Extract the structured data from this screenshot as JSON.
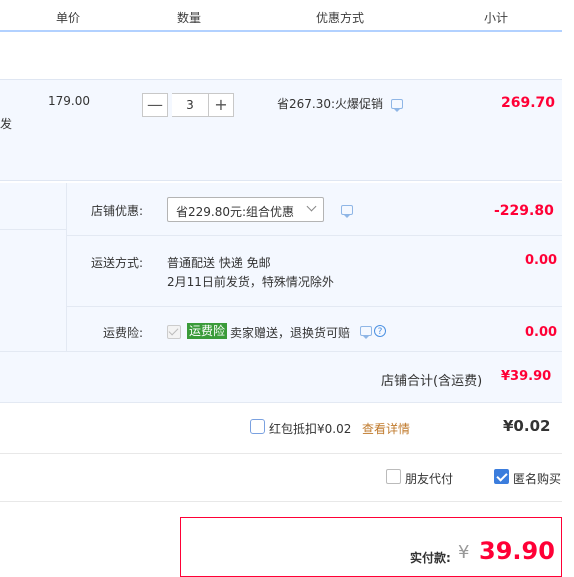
{
  "header": {
    "col_price": "单价",
    "col_qty": "数量",
    "col_promo": "优惠方式",
    "col_subtotal": "小计"
  },
  "item": {
    "title_fragment": "发",
    "unit_price": "179.00",
    "quantity": "3",
    "minus_label": "—",
    "plus_label": "+",
    "promo": "省267.30:火爆促销",
    "subtotal": "269.70"
  },
  "shop": {
    "discount_label": "店铺优惠:",
    "discount_option": "省229.80元:组合优惠",
    "discount_amount": "-229.80",
    "shipping_label": "运送方式:",
    "shipping_method": "普通配送 快递 免邮",
    "shipping_note": "2月11日前发货，特殊情况除外",
    "shipping_amount": "0.00",
    "insurance_label": "运费险:",
    "insurance_badge": "运费险",
    "insurance_text": "卖家赠送，退换货可赔",
    "insurance_amount": "0.00",
    "total_label": "店铺合计(含运费)",
    "total_amount": "¥39.90"
  },
  "redpacket": {
    "label": "红包抵扣¥0.02",
    "link": "查看详情",
    "amount": "¥0.02"
  },
  "options": {
    "friend_pay": "朋友代付",
    "anonymous": "匿名购买"
  },
  "pay": {
    "label": "实付款:",
    "currency": "¥",
    "amount": "39.90"
  },
  "colors": {
    "accent_red": "#ff0036",
    "link_orange": "#c07a2c",
    "header_line": "#b2d1ff",
    "panel_bg": "#f4f8ff"
  }
}
